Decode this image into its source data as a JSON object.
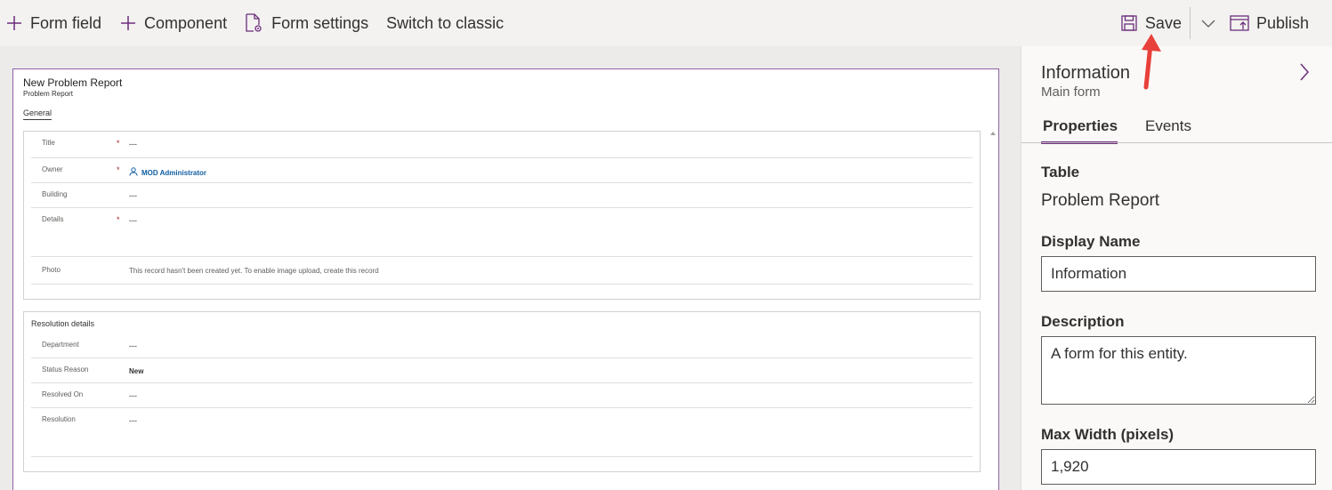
{
  "toolbar": {
    "form_field": "Form field",
    "component": "Component",
    "form_settings": "Form settings",
    "switch_classic": "Switch to classic",
    "save": "Save",
    "publish": "Publish"
  },
  "form": {
    "title": "New Problem Report",
    "subtitle": "Problem Report",
    "tab": "General",
    "section1": {
      "rows": [
        {
          "label": "Title",
          "value": "---"
        },
        {
          "label": "Owner",
          "value": "MOD Administrator"
        },
        {
          "label": "Building",
          "value": "---"
        },
        {
          "label": "Details",
          "value": "---"
        },
        {
          "label": "Photo",
          "value": "This record hasn't been created yet. To enable image upload, create this record"
        }
      ],
      "required_mark": "*"
    },
    "section2": {
      "title": "Resolution details",
      "rows": [
        {
          "label": "Department",
          "value": "---"
        },
        {
          "label": "Status Reason",
          "value": "New"
        },
        {
          "label": "Resolved On",
          "value": "---"
        },
        {
          "label": "Resolution",
          "value": "---"
        }
      ]
    }
  },
  "pane": {
    "title": "Information",
    "subtitle": "Main form",
    "tabs": [
      "Properties",
      "Events"
    ],
    "table_label": "Table",
    "table_value": "Problem Report",
    "display_name_label": "Display Name",
    "display_name_value": "Information",
    "description_label": "Description",
    "description_value": "A form for this entity.",
    "max_width_label": "Max Width (pixels)",
    "max_width_value": "1,920"
  },
  "colors": {
    "accent": "#6b2d7b",
    "annotation_arrow": "#e8403a"
  }
}
